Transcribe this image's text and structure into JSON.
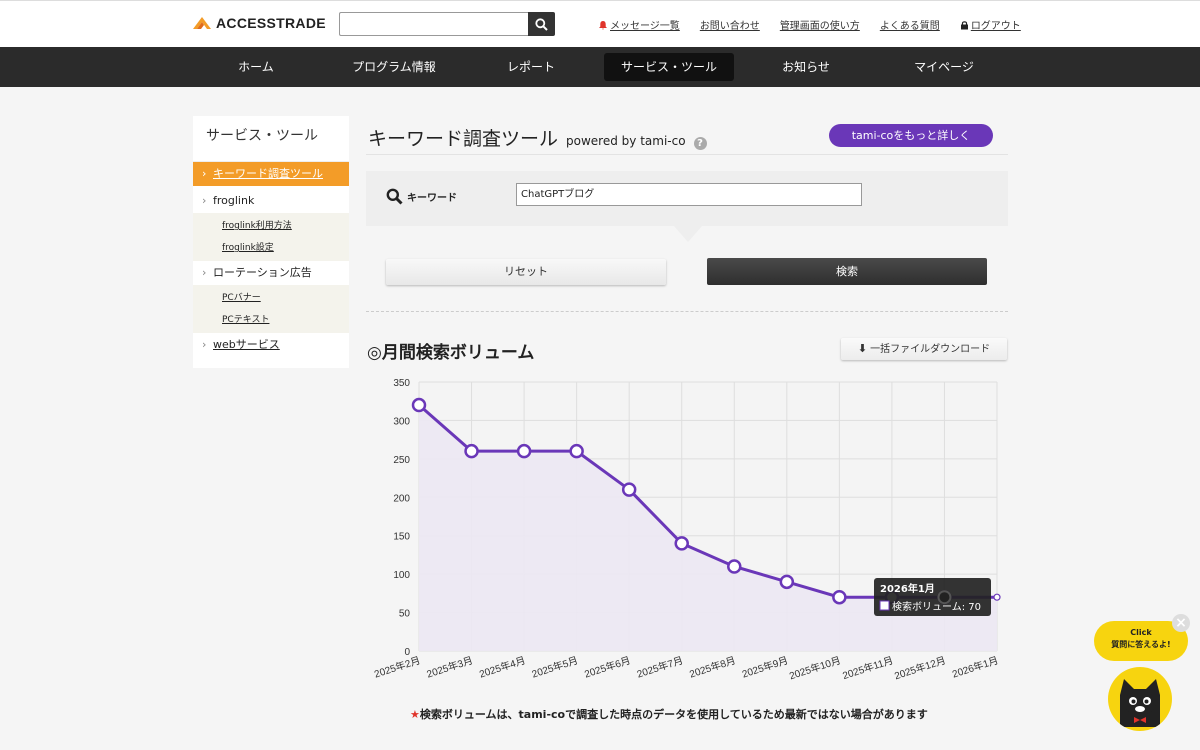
{
  "header": {
    "logo_text": "ACCESSTRADE",
    "search_value": "",
    "links": [
      "メッセージ一覧",
      "お問い合わせ",
      "管理画面の使い方",
      "よくある質問",
      "ログアウト"
    ]
  },
  "nav": {
    "items": [
      "ホーム",
      "プログラム情報",
      "レポート",
      "サービス・ツール",
      "お知らせ",
      "マイページ"
    ],
    "active": "サービス・ツール"
  },
  "sidebar": {
    "title": "サービス・ツール",
    "items": [
      {
        "label": "キーワード調査ツール"
      },
      {
        "label": "froglink",
        "subs": [
          "froglink利用方法",
          "froglink設定"
        ]
      },
      {
        "label": "ローテーション広告",
        "subs": [
          "PCバナー",
          "PCテキスト"
        ]
      },
      {
        "label": "webサービス"
      }
    ]
  },
  "main": {
    "title": "キーワード調査ツール",
    "powered": "powered by tami-co",
    "more_button": "tami-coをもっと詳しく",
    "keyword_label": "キーワード",
    "keyword_value": "ChatGPTブログ",
    "reset_label": "リセット",
    "search_label": "検索",
    "section_title": "◎月間検索ボリューム",
    "download_label": "一括ファイルダウンロード",
    "note_star": "★",
    "note": "検索ボリュームは、tami-coで調査した時点のデータを使用しているため最新ではない場合があります"
  },
  "chart_data": {
    "type": "line",
    "categories": [
      "2025年2月",
      "2025年3月",
      "2025年4月",
      "2025年5月",
      "2025年6月",
      "2025年7月",
      "2025年8月",
      "2025年9月",
      "2025年10月",
      "2025年11月",
      "2025年12月",
      "2026年1月"
    ],
    "series": [
      {
        "name": "検索ボリューム",
        "values": [
          320,
          260,
          260,
          260,
          210,
          140,
          110,
          90,
          70,
          70,
          70,
          70
        ]
      }
    ],
    "ylim": [
      0,
      350
    ],
    "yticks": [
      0,
      50,
      100,
      150,
      200,
      250,
      300,
      350
    ],
    "grid": true,
    "colors": {
      "line": "#6a37b8",
      "fill": "#ece8f3"
    },
    "tooltip": {
      "title": "2026年1月",
      "label": "検索ボリューム: 70"
    }
  },
  "mascot": {
    "click": "Click",
    "prompt": "質問に答えるよ!",
    "close": "×"
  },
  "colors": {
    "accent_orange": "#f39c28",
    "accent_purple": "#6a37b8",
    "nav_bg": "#2b2b2b"
  }
}
